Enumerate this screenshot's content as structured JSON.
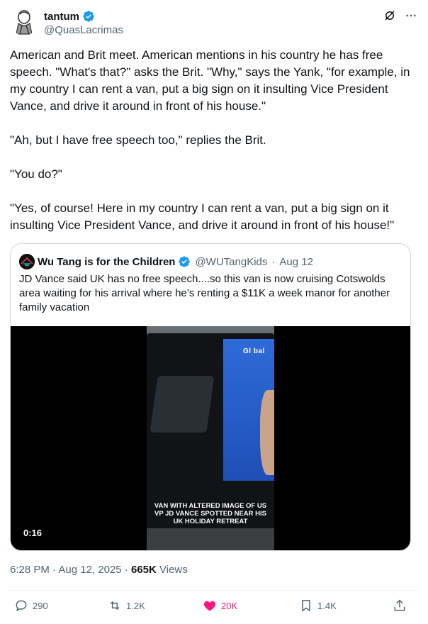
{
  "author": {
    "display_name": "tantum",
    "handle": "@QuasLacrimas",
    "verified_icon": "verified-badge-icon",
    "avatar_icon": "avatar-image"
  },
  "tweet": {
    "paragraphs": [
      "American and Brit meet. American mentions in his country he has free speech. \"What's that?\" asks the Brit. \"Why,\" says the Yank, \"for example, in my country I can rent a van, put a big sign on it insulting Vice President Vance, and drive it around in front of his house.\"",
      "\"Ah, but I have free speech too,\" replies the Brit.",
      "\"You do?\"",
      "\"Yes, of course! Here in my country I can rent a van, put a big sign on it insulting Vice President Vance, and drive it around in front of his house!\""
    ]
  },
  "quote": {
    "display_name": "Wu Tang is for the Children",
    "handle": "@WUTangKids",
    "separator": "·",
    "date": "Aug 12",
    "text": "JD Vance said UK has no free speech....so this van is now cruising Cotswolds area waiting for his arrival where he’s renting a $11K a week manor for another family vacation",
    "video": {
      "caption": "VAN WITH ALTERED IMAGE OF US VP JD VANCE SPOTTED NEAR HIS UK HOLIDAY RETREAT",
      "logo_text": "Gl bal",
      "duration": "0:16"
    }
  },
  "meta": {
    "time": "6:28 PM",
    "sep1": "·",
    "date": "Aug 12, 2025",
    "sep2": "·",
    "views_count": "665K",
    "views_label": "Views"
  },
  "actions": {
    "replies": "290",
    "reposts": "1.2K",
    "likes": "20K",
    "bookmarks": "1.4K"
  },
  "colors": {
    "text": "#0f1419",
    "secondary": "#536471",
    "like": "#f91880",
    "verified": "#1d9bf0",
    "border": "#cfd9de"
  }
}
